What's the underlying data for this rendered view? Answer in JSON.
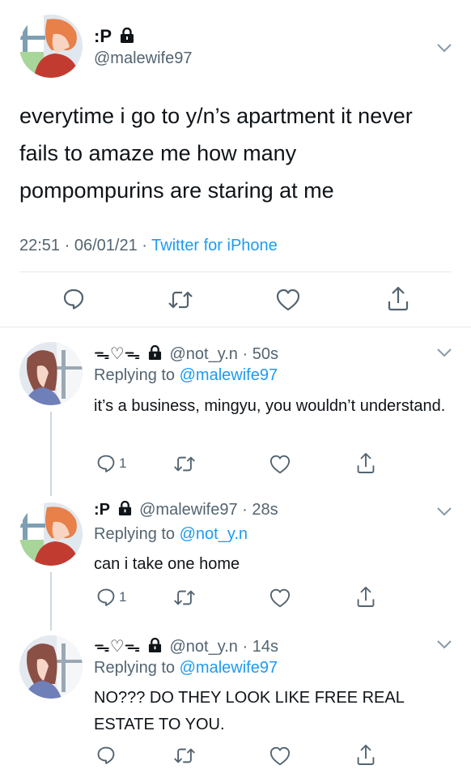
{
  "main_tweet": {
    "display_name": ":P",
    "handle": "@malewife97",
    "text": "everytime i go to y/n’s apartment it never fails to amaze me how many pompompurins are staring at me",
    "time": "22:51",
    "date": "06/01/21",
    "source": "Twitter for iPhone",
    "icons": [
      "lock-icon",
      "chevron-down-icon",
      "reply-icon",
      "retweet-icon",
      "like-icon",
      "share-icon"
    ]
  },
  "replies": [
    {
      "display_name": "ᯓ♡ᯓ",
      "handle": "@not_y.n",
      "age": "50s",
      "replying_label": "Replying to",
      "replying_to": "@malewife97",
      "text": "it’s a business, mingyu, you wouldn’t understand.",
      "reply_count": "1"
    },
    {
      "display_name": ":P",
      "handle": "@malewife97",
      "age": "28s",
      "replying_label": "Replying to",
      "replying_to": "@not_y.n",
      "text": "can i take one home",
      "reply_count": "1"
    },
    {
      "display_name": "ᯓ♡ᯓ",
      "handle": "@not_y.n",
      "age": "14s",
      "replying_label": "Replying to",
      "replying_to": "@malewife97",
      "text": "NO??? DO THEY LOOK LIKE FREE REAL ESTATE TO YOU.",
      "reply_count": ""
    }
  ],
  "separator": "·",
  "colors": {
    "text": "#0f1419",
    "secondary": "#536471",
    "link": "#1d9bf0",
    "divider": "#e6e9ec",
    "thread_line": "#cfd9de"
  }
}
